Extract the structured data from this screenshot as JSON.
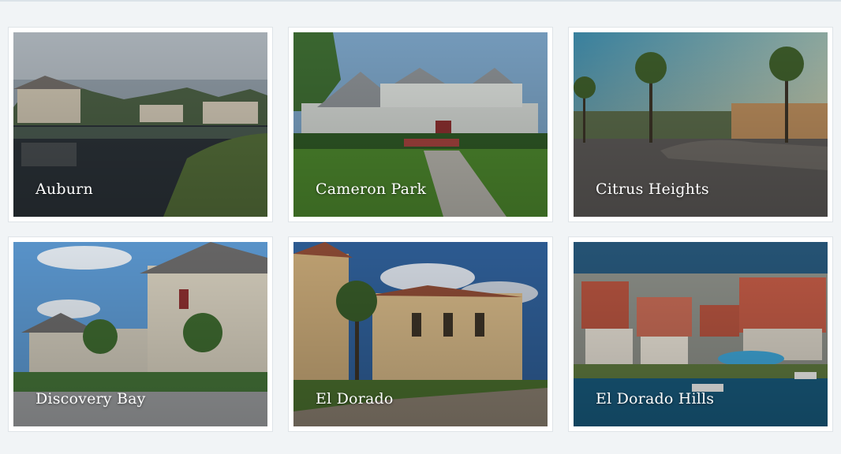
{
  "cities": [
    {
      "label": "Auburn"
    },
    {
      "label": "Cameron Park"
    },
    {
      "label": "Citrus Heights"
    },
    {
      "label": "Discovery Bay"
    },
    {
      "label": "El Dorado"
    },
    {
      "label": "El Dorado Hills"
    }
  ]
}
